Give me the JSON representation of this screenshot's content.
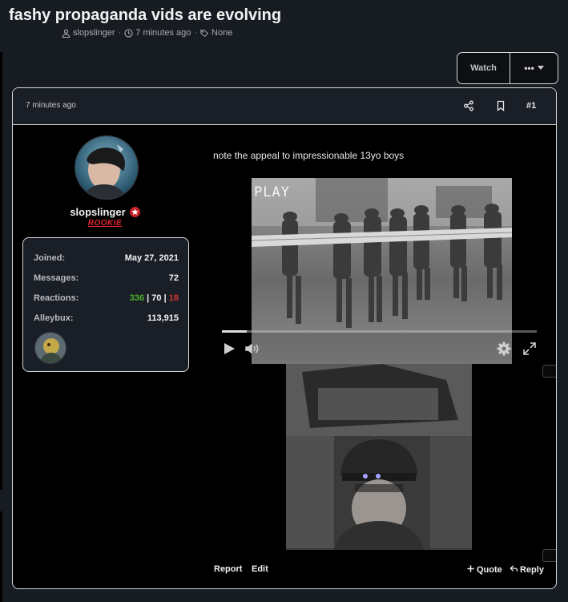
{
  "thread": {
    "title": "fashy propaganda vids are evolving",
    "author": "slopslinger",
    "time": "7 minutes ago",
    "tags": "None"
  },
  "actions": {
    "watch_label": "Watch",
    "more_label": "•••"
  },
  "post": {
    "date": "7 minutes ago",
    "number": "#1",
    "text": "note the appeal to impressionable 13yo boys",
    "video_overlay_text": "PLAY",
    "video_progress": 0.08
  },
  "user": {
    "username": "slopslinger",
    "rank": "ROOKIE",
    "stats": {
      "joined_label": "Joined:",
      "joined_value": "May 27, 2021",
      "messages_label": "Messages:",
      "messages_value": "72",
      "reactions_label": "Reactions:",
      "reactions_positive": "336",
      "reactions_neutral": "70",
      "reactions_negative": "18",
      "reactions_sep": "|",
      "alleybux_label": "Alleybux:",
      "alleybux_value": "113,915"
    }
  },
  "footer": {
    "report": "Report",
    "edit": "Edit",
    "quote": "Quote",
    "reply": "Reply"
  },
  "icons": [
    "user-icon",
    "clock-icon",
    "tag-icon",
    "share-icon",
    "bookmark-icon",
    "play-icon",
    "volume-icon",
    "settings-icon",
    "fullscreen-icon",
    "plus-icon",
    "reply-icon",
    "star-icon"
  ],
  "colors": {
    "background": "#171b22",
    "post_background": "#000000",
    "border": "#d8d8d8",
    "rank": "#e3232c",
    "reaction_positive": "#4caf2e",
    "reaction_negative": "#d4352c"
  }
}
